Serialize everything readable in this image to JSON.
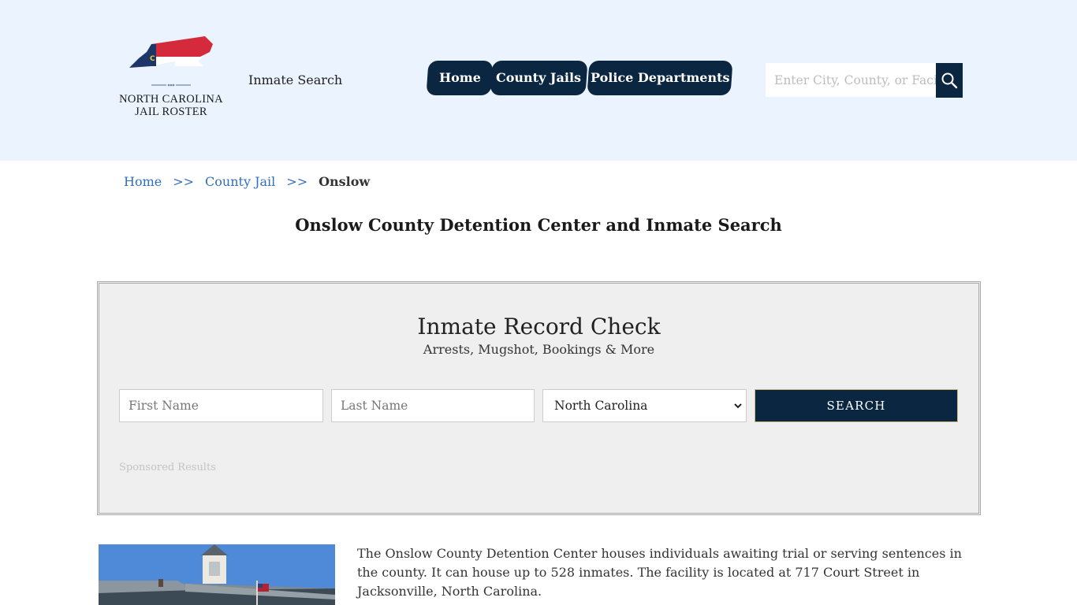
{
  "header": {
    "logo": {
      "line1": "NORTH CAROLINA",
      "line2": "JAIL ROSTER",
      "flag_colors": {
        "red": "#d42a3b",
        "blue": "#1c3668"
      }
    },
    "site_label": "Inmate Search",
    "nav": [
      {
        "label": "Home"
      },
      {
        "label": "County Jails"
      },
      {
        "label": "Police Departments"
      }
    ],
    "search": {
      "placeholder": "Enter City, County, or Facility",
      "icon": "search-icon"
    }
  },
  "breadcrumb": {
    "items": [
      {
        "label": "Home"
      },
      {
        "label": "County Jail"
      }
    ],
    "separator": ">>",
    "current": "Onslow"
  },
  "page_title": "Onslow County Detention Center and Inmate Search",
  "record_check": {
    "title": "Inmate Record Check",
    "subtitle": "Arrests, Mugshot, Bookings & More",
    "first_name_placeholder": "First Name",
    "last_name_placeholder": "Last Name",
    "state_selected": "North Carolina",
    "search_label": "SEARCH",
    "sponsored_label": "Sponsored Results"
  },
  "intro_text": "The Onslow County Detention Center houses individuals awaiting trial or serving sentences in the county. It can house up to 528 inmates. The facility is located at 717 Court Street in Jacksonville, North Carolina.",
  "colors": {
    "header_bg": "#ebf3fe",
    "nav_bg": "#0b2640",
    "link": "#2f6fbf",
    "panel_bg": "#efefef"
  }
}
